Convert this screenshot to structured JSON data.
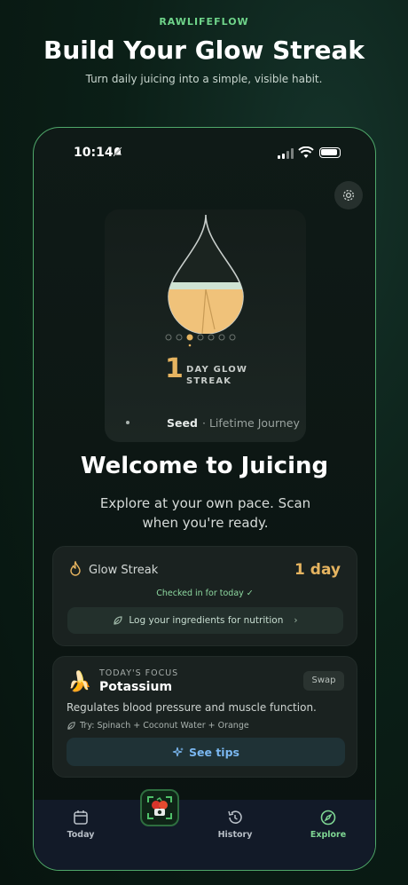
{
  "header": {
    "brand": "RAWLIFEFLOW",
    "title": "Build Your Glow Streak",
    "subtitle": "Turn daily juicing into a simple, visible habit."
  },
  "status_bar": {
    "time": "10:14"
  },
  "streak": {
    "count": "1",
    "label": "DAY GLOW STREAK",
    "level": "Seed",
    "journey": "· Lifetime Journey"
  },
  "welcome": {
    "title": "Welcome to Juicing",
    "body": "Explore at your own pace. Scan when you're ready."
  },
  "glow_card": {
    "label": "Glow Streak",
    "value": "1 day",
    "status": "Checked in for today ✓",
    "log_button": "Log your ingredients for nutrition"
  },
  "focus_card": {
    "eyebrow": "TODAY'S FOCUS",
    "title": "Potassium",
    "swap": "Swap",
    "description": "Regulates blood pressure and muscle function.",
    "try": "Try: Spinach + Coconut Water + Orange",
    "tips_button": "See tips"
  },
  "tabs": [
    {
      "label": "Today"
    },
    {
      "label": "History"
    },
    {
      "label": "Explore"
    }
  ],
  "colors": {
    "accent_green": "#6fd48a",
    "streak_gold": "#e6b460",
    "link_blue": "#7ab7f0"
  }
}
